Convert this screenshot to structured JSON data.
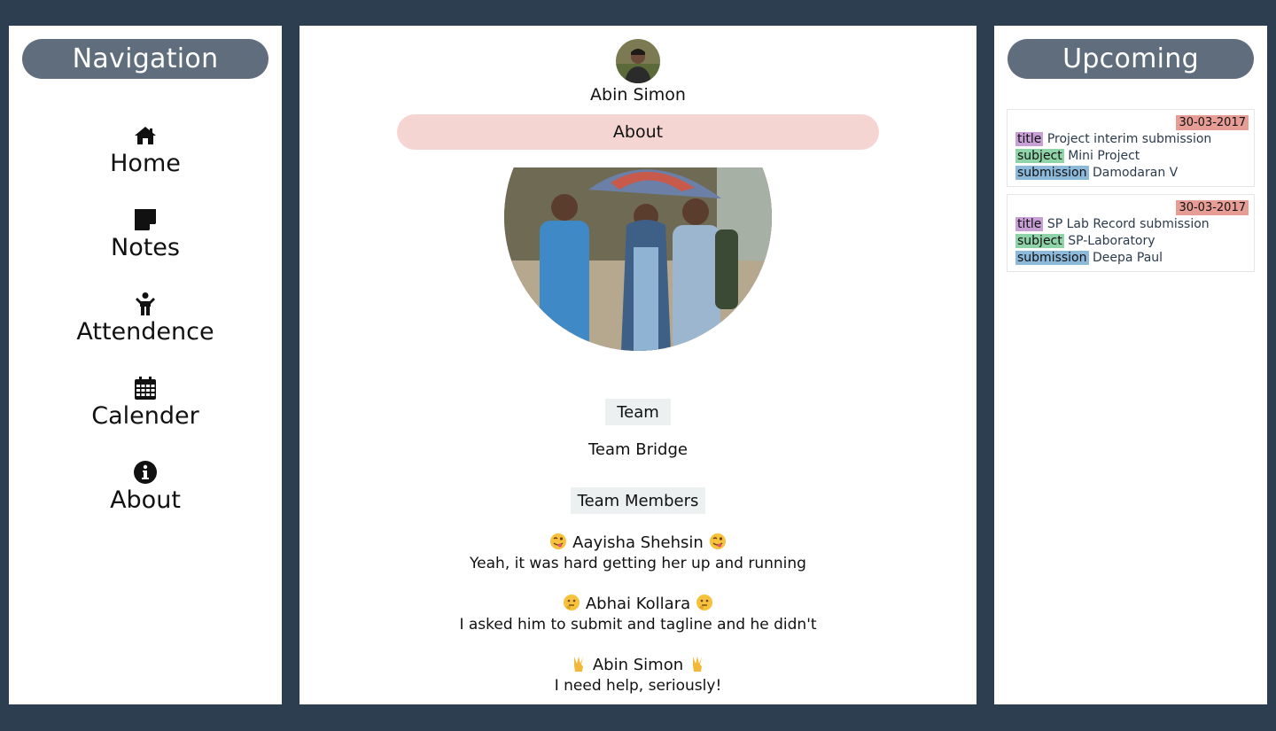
{
  "nav": {
    "header": "Navigation",
    "items": [
      {
        "label": "Home",
        "icon": "home-icon"
      },
      {
        "label": "Notes",
        "icon": "sticky-note-icon"
      },
      {
        "label": "Attendence",
        "icon": "child-icon"
      },
      {
        "label": "Calender",
        "icon": "calendar-icon"
      },
      {
        "label": "About",
        "icon": "info-circle-icon"
      }
    ]
  },
  "profile": {
    "name": "Abin Simon",
    "section": "About",
    "team_label": "Team",
    "team_name": "Team Bridge",
    "members_label": "Team Members",
    "members": [
      {
        "name": "Aayisha Shehsin",
        "line": "Yeah, it was hard getting her up and running",
        "emoji": "winking-tongue-emoji"
      },
      {
        "name": "Abhai Kollara",
        "line": "I asked him to submit and tagline and he didn't",
        "emoji": "thinking-emoji"
      },
      {
        "name": "Abin Simon",
        "line": "I need help, seriously!",
        "emoji": "victory-hand-emoji"
      }
    ]
  },
  "upcoming": {
    "header": "Upcoming",
    "key_title": "title",
    "key_subject": "subject",
    "key_submission": "submission",
    "items": [
      {
        "date": "30-03-2017",
        "title": "Project interim submission",
        "subject": "Mini Project",
        "submission": "Damodaran V"
      },
      {
        "date": "30-03-2017",
        "title": "SP Lab Record submission",
        "subject": "SP-Laboratory",
        "submission": "Deepa Paul"
      }
    ]
  },
  "colors": {
    "background": "#2c3e50",
    "header_pill": "#5f6d7c",
    "about_bar": "#f5d5d2",
    "date_badge": "#e59d95",
    "title_tag": "#c8a0d6",
    "subject_tag": "#8fd3a9",
    "submission_tag": "#8db9db"
  }
}
